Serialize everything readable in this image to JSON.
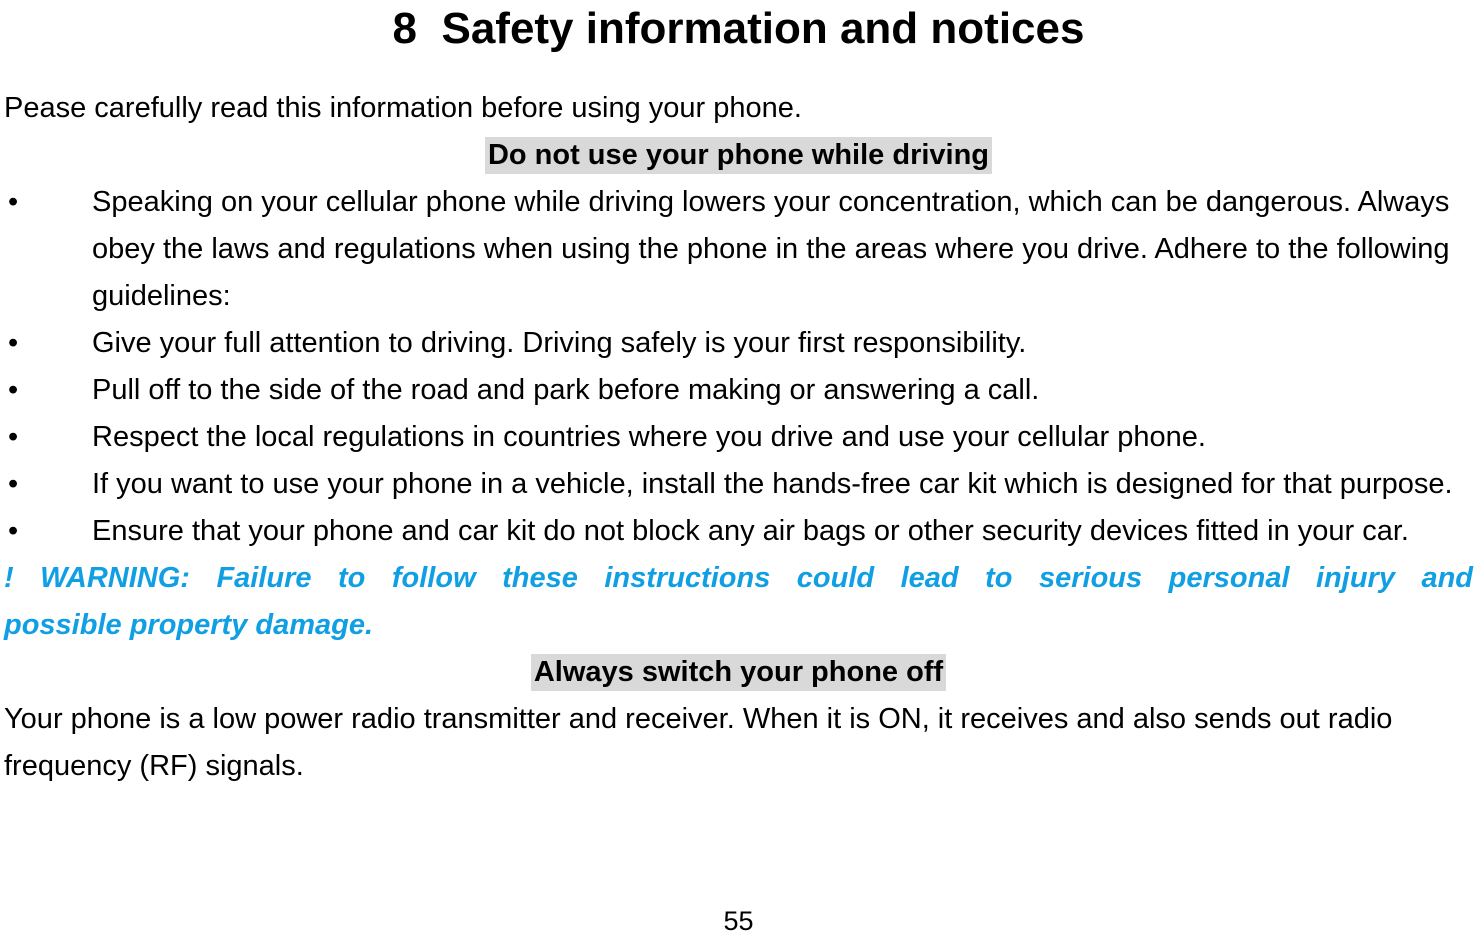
{
  "document": {
    "chapter_number": "8",
    "title": "Safety information and notices",
    "title_full": "8  Safety information and notices",
    "page_number": "55"
  },
  "intro": {
    "text": "Pease carefully read this information before using your phone."
  },
  "sections": [
    {
      "heading": "Do not use your phone while driving",
      "heading_highlight_color": "#d9d9d9",
      "bullets": [
        "Speaking on your cellular phone while driving lowers your concentration, which can be dangerous. Always obey the laws and regulations when using the phone in the areas where you drive. Adhere to the following guidelines:",
        "Give your full attention to driving. Driving safely is your first responsibility.",
        "Pull off to the side of the road and park before making or answering a call.",
        "Respect the local regulations in countries where you drive and use your cellular phone.",
        "If you want to use your phone in a vehicle, install the hands-free car kit which is designed for that purpose.",
        "Ensure that your phone and car kit do not block any air bags or other security devices fitted in your car."
      ],
      "bullet_marker": "•"
    },
    {
      "heading": "Always switch your phone off",
      "heading_highlight_color": "#d9d9d9",
      "paragraph": "Your phone is a low power radio transmitter and receiver. When it is ON, it receives and also sends out radio frequency (RF) signals."
    }
  ],
  "warning": {
    "color": "#119fe4",
    "line_1": "!  WARNING:  Failure  to  follow  these  instructions  could  lead  to  serious  personal  injury  and",
    "line_2": "possible property damage.",
    "full_text": "! WARNING: Failure to follow these instructions could lead to serious personal injury and possible property damage."
  }
}
